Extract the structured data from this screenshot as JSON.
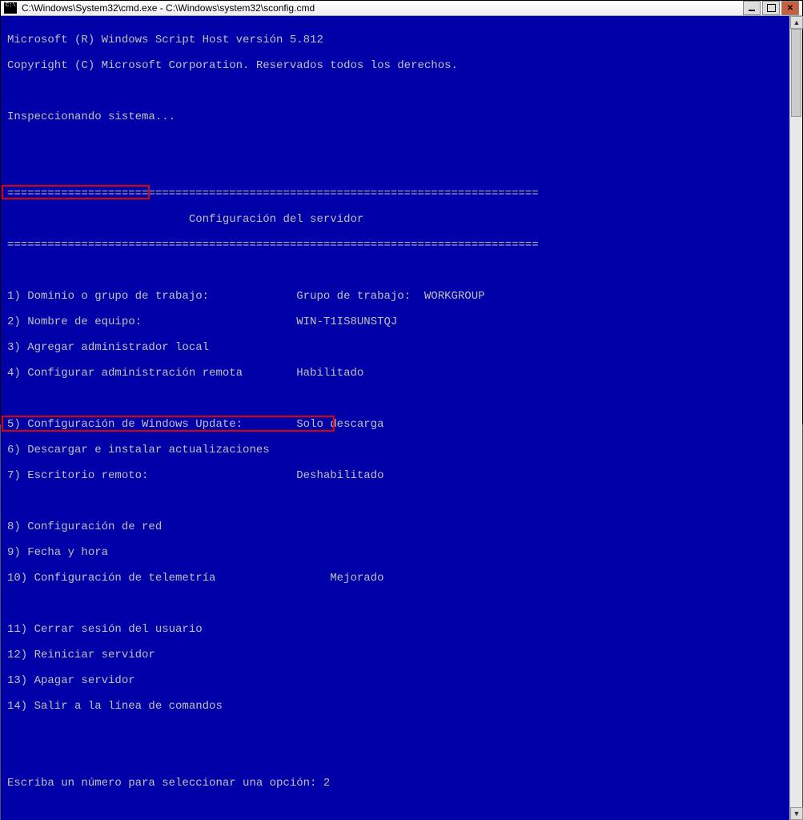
{
  "title": "C:\\Windows\\System32\\cmd.exe - C:\\Windows\\system32\\sconfig.cmd",
  "cmdIconText": "C:\\.",
  "header1": "Microsoft (R) Windows Script Host versión 5.812",
  "header2": "Copyright (C) Microsoft Corporation. Reservados todos los derechos.",
  "inspect": "Inspeccionando sistema...",
  "divider": "===============================================================================",
  "bannerTitle": "                           Configuración del servidor",
  "menu": {
    "r1": {
      "label": "1) Dominio o grupo de trabajo:             Grupo de trabajo:  WORKGROUP"
    },
    "r2": {
      "label": "2) Nombre de equipo:                       WIN-T1IS8UNSTQJ"
    },
    "r3": {
      "label": "3) Agregar administrador local"
    },
    "r4": {
      "label": "4) Configurar administración remota        Habilitado"
    },
    "r5": {
      "label": "5) Configuración de Windows Update:        Solo descarga"
    },
    "r6": {
      "label": "6) Descargar e instalar actualizaciones"
    },
    "r7": {
      "label": "7) Escritorio remoto:                      Deshabilitado"
    },
    "r8": {
      "label": "8) Configuración de red"
    },
    "r9": {
      "label": "9) Fecha y hora"
    },
    "r10": {
      "label": "10) Configuración de telemetría                 Mejorado"
    },
    "r11": {
      "label": "11) Cerrar sesión del usuario"
    },
    "r12": {
      "label": "12) Reiniciar servidor"
    },
    "r13": {
      "label": "13) Apagar servidor"
    },
    "r14": {
      "label": "14) Salir a la línea de comandos"
    }
  },
  "prompt": "Escriba un número para seleccionar una opción: 2",
  "colors": {
    "consoleBg": "#0000a8",
    "consoleFg": "#c0c0c0",
    "highlight": "#e00000"
  }
}
